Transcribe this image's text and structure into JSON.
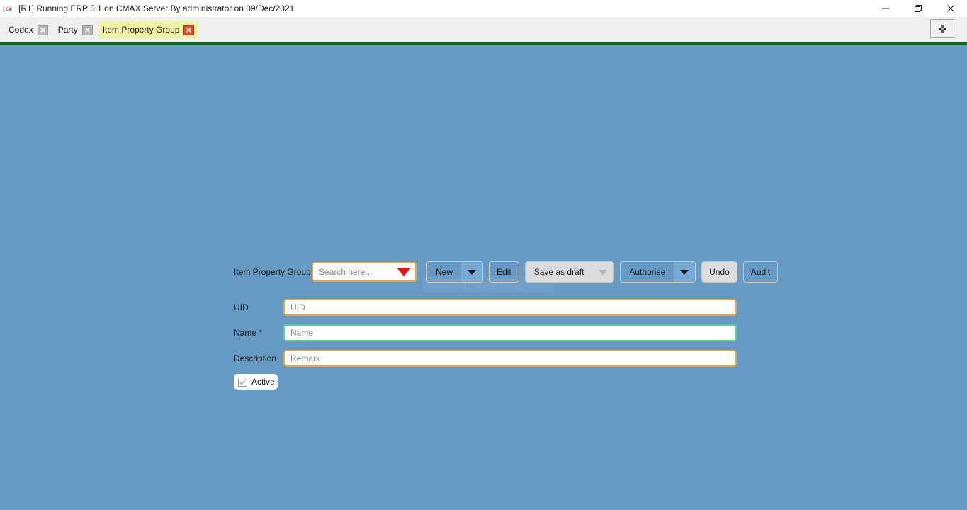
{
  "window": {
    "title": "[R1] Running ERP 5.1 on CMAX Server By administrator on 09/Dec/2021",
    "app_icon": "erp-bracket-icon",
    "controls": {
      "minimize": "minimize-icon",
      "restore": "restore-icon",
      "close": "close-icon"
    }
  },
  "tabs": {
    "items": [
      {
        "label": "Codex",
        "active": false,
        "close": "close-icon"
      },
      {
        "label": "Party",
        "active": false,
        "close": "close-icon"
      },
      {
        "label": "Item Property Group",
        "active": true,
        "close": "close-icon"
      }
    ],
    "new_tab": "plus-icon"
  },
  "form": {
    "section_label": "Item Property Group",
    "search": {
      "placeholder": "Search here...",
      "value": "",
      "caret": "dropdown-caret-icon"
    },
    "toolbar": {
      "new_label": "New",
      "new_caret": "caret-down-icon",
      "edit_label": "Edit",
      "save_draft_label": "Save as draft",
      "save_draft_caret": "caret-down-icon",
      "authorise_label": "Authorise",
      "authorise_caret": "caret-down-icon",
      "undo_label": "Undo",
      "audit_label": "Audit"
    },
    "fields": [
      {
        "label": "UID",
        "placeholder": "UID",
        "value": "",
        "border": "#e8a33d"
      },
      {
        "label": "Name *",
        "placeholder": "Name",
        "value": "",
        "border": "#4ddb7c"
      },
      {
        "label": "Description",
        "placeholder": "Remark",
        "value": "",
        "border": "#e8a33d"
      }
    ],
    "active_checkbox": {
      "label": "Active",
      "checked": true,
      "icon": "check-icon"
    }
  },
  "overlay": {
    "watermark_text": "Full-screen Snip"
  },
  "colors": {
    "content_bg": "#6699c4",
    "tabbar_bg": "#efefef",
    "active_tab_bg": "#f2f2a0",
    "green_strip": "#0a6b15",
    "field_border_orange": "#e8a33d",
    "field_border_green": "#4ddb7c",
    "caret_red": "#e01b1b",
    "close_red": "#e8462a"
  }
}
